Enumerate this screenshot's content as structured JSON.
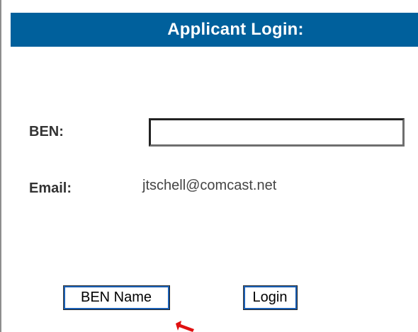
{
  "header": {
    "title": "Applicant Login:"
  },
  "form": {
    "ben_label": "BEN:",
    "ben_value": "",
    "email_label": "Email:",
    "email_value": "jtschell@comcast.net"
  },
  "buttons": {
    "ben_name_label": "BEN Name",
    "login_label": "Login"
  },
  "colors": {
    "header_bg": "#00609c",
    "header_text": "#ffffff",
    "label_text": "#333333",
    "cursor_red": "#e01010"
  },
  "icons": {
    "cursor": "red-arrow-pointer-icon"
  }
}
